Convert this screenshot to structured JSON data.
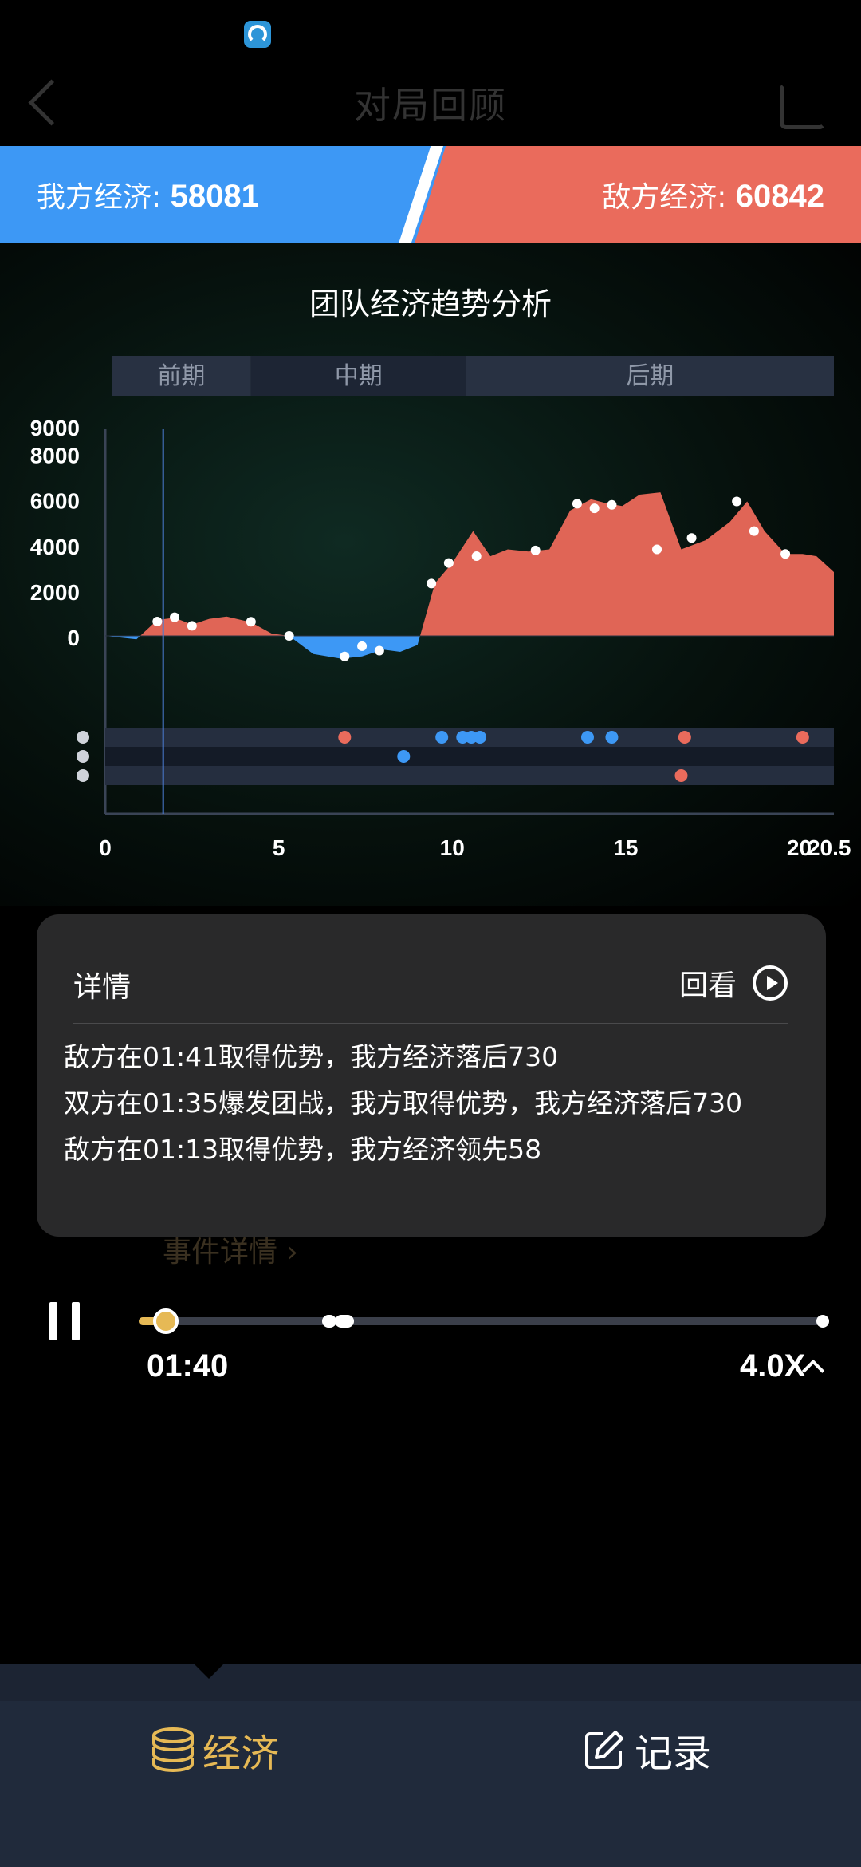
{
  "header": {
    "title": "对局回顾"
  },
  "banner": {
    "our_label": "我方经济: ",
    "our_value": "58081",
    "enemy_label": "敌方经济: ",
    "enemy_value": "60842",
    "our_color": "#3d98f5",
    "enemy_color": "#ea6b5c"
  },
  "chart_data": {
    "type": "area",
    "title": "团队经济趋势分析",
    "phases": [
      {
        "label": "前期",
        "start": 0,
        "end": 4.2
      },
      {
        "label": "中期",
        "start": 4.2,
        "end": 10.4
      },
      {
        "label": "后期",
        "start": 10.4,
        "end": 21.0
      }
    ],
    "y_tick_labels": [
      "9000",
      "8000",
      "6000",
      "4000",
      "2000",
      "0"
    ],
    "y_ticks": [
      9000,
      8000,
      6000,
      4000,
      2000,
      0
    ],
    "ylim": [
      -1600,
      9000
    ],
    "x_tick_labels": [
      "0",
      "5",
      "10",
      "15",
      "20",
      "20.5"
    ],
    "x_ticks": [
      0,
      5,
      10,
      15,
      20,
      20.5
    ],
    "xlim": [
      0,
      21
    ],
    "current_time": 1.67,
    "series": [
      {
        "positive_color": "#e06556",
        "negative_color": "#3d98f5",
        "x": [
          0,
          0.9,
          1.5,
          2.0,
          2.5,
          3.0,
          3.5,
          4.2,
          4.8,
          5.3,
          6.0,
          6.8,
          7.4,
          8.0,
          8.5,
          9.0,
          9.5,
          10.0,
          10.6,
          11.1,
          11.6,
          12.2,
          12.8,
          13.4,
          14.0,
          14.5,
          14.9,
          15.4,
          16.0,
          16.6,
          17.3,
          18.0,
          18.5,
          19.0,
          19.6,
          20.1,
          20.5,
          21.0
        ],
        "y": [
          0,
          -150,
          700,
          800,
          500,
          750,
          850,
          600,
          100,
          0,
          -800,
          -1000,
          -900,
          -600,
          -700,
          -400,
          2300,
          3200,
          4600,
          3500,
          3800,
          3700,
          3800,
          5500,
          6000,
          5800,
          5700,
          6200,
          6300,
          3800,
          4200,
          5000,
          5900,
          4600,
          3600,
          3600,
          3500,
          2800
        ]
      }
    ],
    "points": [
      {
        "x": 1.5,
        "y": 630
      },
      {
        "x": 2.0,
        "y": 820
      },
      {
        "x": 2.5,
        "y": 440
      },
      {
        "x": 4.2,
        "y": 620
      },
      {
        "x": 5.3,
        "y": 0
      },
      {
        "x": 6.9,
        "y": -900
      },
      {
        "x": 7.4,
        "y": -450
      },
      {
        "x": 7.9,
        "y": -650
      },
      {
        "x": 9.4,
        "y": 2300
      },
      {
        "x": 9.9,
        "y": 3200
      },
      {
        "x": 10.7,
        "y": 3500
      },
      {
        "x": 12.4,
        "y": 3750
      },
      {
        "x": 13.6,
        "y": 5800
      },
      {
        "x": 14.1,
        "y": 5600
      },
      {
        "x": 14.6,
        "y": 5750
      },
      {
        "x": 15.9,
        "y": 3800
      },
      {
        "x": 16.9,
        "y": 4300
      },
      {
        "x": 18.2,
        "y": 5900
      },
      {
        "x": 18.7,
        "y": 4600
      },
      {
        "x": 19.6,
        "y": 3600
      }
    ],
    "event_rows": [
      {
        "icon": "tower-icon",
        "events": [
          {
            "x": 6.9,
            "team": "enemy"
          },
          {
            "x": 9.7,
            "team": "ours"
          },
          {
            "x": 10.3,
            "team": "ours"
          },
          {
            "x": 10.55,
            "team": "ours"
          },
          {
            "x": 10.8,
            "team": "ours"
          },
          {
            "x": 13.9,
            "team": "ours"
          },
          {
            "x": 14.6,
            "team": "ours"
          },
          {
            "x": 16.7,
            "team": "enemy"
          },
          {
            "x": 20.1,
            "team": "enemy"
          }
        ]
      },
      {
        "icon": "dragon-icon",
        "events": [
          {
            "x": 8.6,
            "team": "ours"
          }
        ]
      },
      {
        "icon": "demon-icon",
        "events": [
          {
            "x": 16.6,
            "team": "enemy"
          }
        ]
      }
    ]
  },
  "detail": {
    "title": "详情",
    "replay_label": "回看",
    "events": [
      "敌方在01:41取得优势，我方经济落后730",
      "双方在01:35爆发团战，我方取得优势，我方经济落后730",
      "敌方在01:13取得优势，我方经济领先58"
    ],
    "event_details_link": "事件详情 ›"
  },
  "playback": {
    "time": "01:40",
    "speed": "4.0X",
    "progress": 0.04
  },
  "bottom_nav": {
    "economy_label": "经济",
    "record_label": "记录",
    "active": "economy",
    "active_color": "#e6b955"
  }
}
